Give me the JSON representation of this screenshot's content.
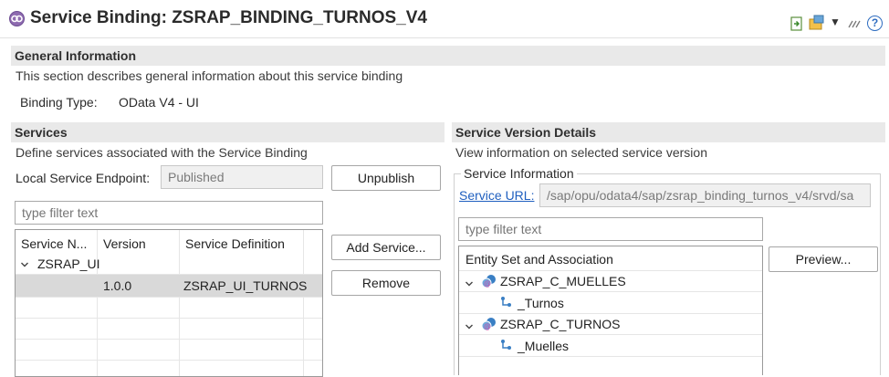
{
  "editor": {
    "title": "Service Binding: ZSRAP_BINDING_TURNOS_V4"
  },
  "toolbar": {
    "icons": [
      "publish-preview-icon",
      "run-dropdown-icon",
      "chevron-down-icon",
      "link-icon",
      "help-icon"
    ],
    "help_glyph": "?"
  },
  "general": {
    "header": "General Information",
    "description": "This section describes general information about this service binding",
    "binding_type_label": "Binding Type:",
    "binding_type_value": "OData V4 - UI"
  },
  "services": {
    "header": "Services",
    "description": "Define services associated with the Service Binding",
    "endpoint_label": "Local Service Endpoint:",
    "endpoint_value": "Published",
    "unpublish_label": "Unpublish",
    "filter_placeholder": "type filter text",
    "columns": [
      "Service N...",
      "Version",
      "Service Definition"
    ],
    "rows": [
      {
        "name": "ZSRAP_UI",
        "version": "",
        "definition": ""
      },
      {
        "name": "",
        "version": "1.0.0",
        "definition": "ZSRAP_UI_TURNOS"
      }
    ],
    "add_service_label": "Add Service...",
    "remove_label": "Remove"
  },
  "version_details": {
    "header": "Service Version Details",
    "description": "View information on selected service version",
    "info_group_label": "Service Information",
    "service_url_label": "Service URL:",
    "service_url_value": "/sap/opu/odata4/sap/zsrap_binding_turnos_v4/srvd/sa",
    "filter_placeholder": "type filter text",
    "tree_header": "Entity Set and Association",
    "tree": [
      {
        "label": "ZSRAP_C_MUELLES",
        "child": "_Turnos"
      },
      {
        "label": "ZSRAP_C_TURNOS",
        "child": "_Muelles"
      }
    ],
    "preview_label": "Preview..."
  },
  "colors": {
    "section_header_bg": "#e9e9e9",
    "link": "#1f5fbf",
    "selected_row": "#d9d9d9"
  }
}
